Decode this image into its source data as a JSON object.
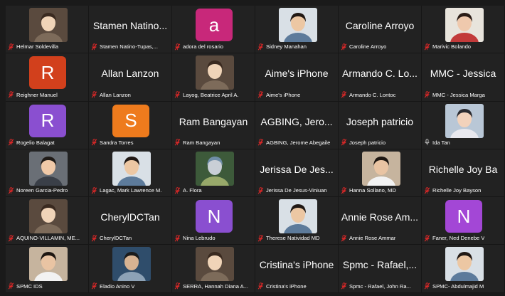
{
  "colors": {
    "background": "#1a1a1a",
    "tile": "#222222",
    "mute_red": "#e02828",
    "avatar_pink": "#c8287a",
    "avatar_orange": "#e26a25",
    "avatar_red": "#d2401c",
    "avatar_purple": "#8a4fd0",
    "avatar_orange2": "#ee7b1d",
    "avatar_purple2": "#a347d6"
  },
  "participants": [
    {
      "name": "Helmar Soldevilla",
      "tile_type": "photo",
      "muted": true
    },
    {
      "name": "Stamen Natino-Tupas,...",
      "display": "Stamen Natino...",
      "tile_type": "name",
      "muted": true
    },
    {
      "name": "adora del rosario",
      "tile_type": "avatar",
      "initial": "a",
      "avatar_color": "#c8287a",
      "muted": true
    },
    {
      "name": "Sidney Manahan",
      "tile_type": "photo",
      "muted": true
    },
    {
      "name": "Caroline Arroyo",
      "display": "Caroline Arroyo",
      "tile_type": "name",
      "muted": true
    },
    {
      "name": "Marivic Bolando",
      "tile_type": "photo",
      "muted": true
    },
    {
      "name": "Reighner Manuel",
      "tile_type": "avatar",
      "initial": "R",
      "avatar_color": "#d2401c",
      "muted": true
    },
    {
      "name": "Allan Lanzon",
      "display": "Allan Lanzon",
      "tile_type": "name",
      "muted": true
    },
    {
      "name": "Layog, Beatrice April A.",
      "tile_type": "photo",
      "muted": true
    },
    {
      "name": "Aime's iPhone",
      "display": "Aime's iPhone",
      "tile_type": "name",
      "muted": true
    },
    {
      "name": "Armando C. Lontoc",
      "display": "Armando C. Lo...",
      "tile_type": "name",
      "muted": true
    },
    {
      "name": "MMC - Jessica Marga",
      "display": "MMC - Jessica",
      "tile_type": "name",
      "muted": true
    },
    {
      "name": "Rogelio Balagat",
      "tile_type": "avatar",
      "initial": "R",
      "avatar_color": "#8a4fd0",
      "muted": true
    },
    {
      "name": "Sandra Torres",
      "tile_type": "avatar",
      "initial": "S",
      "avatar_color": "#ee7b1d",
      "muted": true
    },
    {
      "name": "Ram Bangayan",
      "display": "Ram Bangayan",
      "tile_type": "name",
      "muted": true
    },
    {
      "name": "AGBING, Jerome Abegaile",
      "display": "AGBING, Jero...",
      "tile_type": "name",
      "muted": true
    },
    {
      "name": "Joseph patricio",
      "display": "Joseph patricio",
      "tile_type": "name",
      "muted": true
    },
    {
      "name": "Ida Tan",
      "tile_type": "photo",
      "muted": false
    },
    {
      "name": "Noreen Garcia-Pedro",
      "tile_type": "photo",
      "muted": true
    },
    {
      "name": "Lagac, Mark Lawrence M.",
      "tile_type": "photo",
      "muted": true
    },
    {
      "name": "A. Flora",
      "tile_type": "photo",
      "muted": true
    },
    {
      "name": "Jerissa De Jesus-Viniuan",
      "display": "Jerissa De Jes...",
      "tile_type": "name",
      "muted": true
    },
    {
      "name": "Hanna Sollano, MD",
      "tile_type": "photo",
      "muted": true
    },
    {
      "name": "Richelle Joy Bayson",
      "display": "Richelle Joy Ba",
      "tile_type": "name",
      "muted": true
    },
    {
      "name": "AQUINO-VILLAMIN, ME...",
      "tile_type": "photo",
      "muted": true
    },
    {
      "name": "CherylDCTan",
      "display": "CherylDCTan",
      "tile_type": "name",
      "muted": true
    },
    {
      "name": "Nina Lebrudo",
      "tile_type": "avatar",
      "initial": "N",
      "avatar_color": "#8a4fd0",
      "muted": true
    },
    {
      "name": "Therese Natividad MD",
      "tile_type": "photo",
      "muted": true
    },
    {
      "name": "Annie Rose Ammar",
      "display": "Annie Rose Am...",
      "tile_type": "name",
      "muted": true
    },
    {
      "name": "Faner, Ned Denebe V",
      "tile_type": "avatar",
      "initial": "N",
      "avatar_color": "#a347d6",
      "muted": true
    },
    {
      "name": "SPMC IDS",
      "tile_type": "photo",
      "muted": true
    },
    {
      "name": "Eladio Anino V",
      "tile_type": "photo",
      "muted": true
    },
    {
      "name": "SERRA, Hannah Diana A...",
      "tile_type": "photo",
      "muted": true
    },
    {
      "name": "Cristina's iPhone",
      "display": "Cristina's iPhone",
      "tile_type": "name",
      "muted": true
    },
    {
      "name": "Spmc - Rafael, John Ra...",
      "display": "Spmc - Rafael,...",
      "tile_type": "name",
      "muted": true
    },
    {
      "name": "SPMC- Abdulmajid M",
      "tile_type": "photo",
      "muted": true
    }
  ]
}
